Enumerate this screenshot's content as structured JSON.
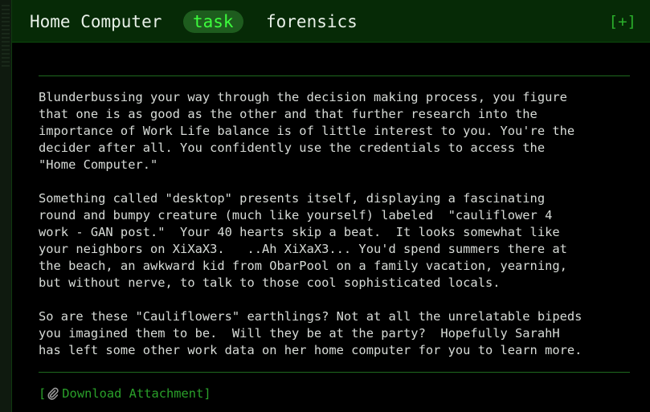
{
  "header": {
    "title": "Home Computer",
    "tabs": [
      {
        "label": "task",
        "active": true
      },
      {
        "label": "forensics",
        "active": false
      }
    ],
    "expand_label": "[+]"
  },
  "content": {
    "paragraphs": [
      "Blunderbussing your way through the decision making process, you figure\nthat one is as good as the other and that further research into the\nimportance of Work Life balance is of little interest to you. You're the\ndecider after all. You confidently use the credentials to access the\n\"Home Computer.\"",
      "Something called \"desktop\" presents itself, displaying a fascinating\nround and bumpy creature (much like yourself) labeled  \"cauliflower 4\nwork - GAN post.\"  Your 40 hearts skip a beat.  It looks somewhat like\nyour neighbors on XiXaX3.   ..Ah XiXaX3... You'd spend summers there at\nthe beach, an awkward kid from ObarPool on a family vacation, yearning,\nbut without nerve, to talk to those cool sophisticated locals.",
      "So are these \"Cauliflowers\" earthlings? Not at all the unrelatable bipeds\nyou imagined them to be.  Will they be at the party?  Hopefully SarahH\nhas left some other work data on her home computer for you to learn more."
    ]
  },
  "attachment": {
    "open_bracket": "[",
    "icon": "paperclip-icon",
    "label": "Download Attachment",
    "close_bracket": "]"
  },
  "colors": {
    "header_bg": "#062a06",
    "accent": "#3dff3d",
    "link": "#2aa02a",
    "text": "#d8dcd8"
  }
}
